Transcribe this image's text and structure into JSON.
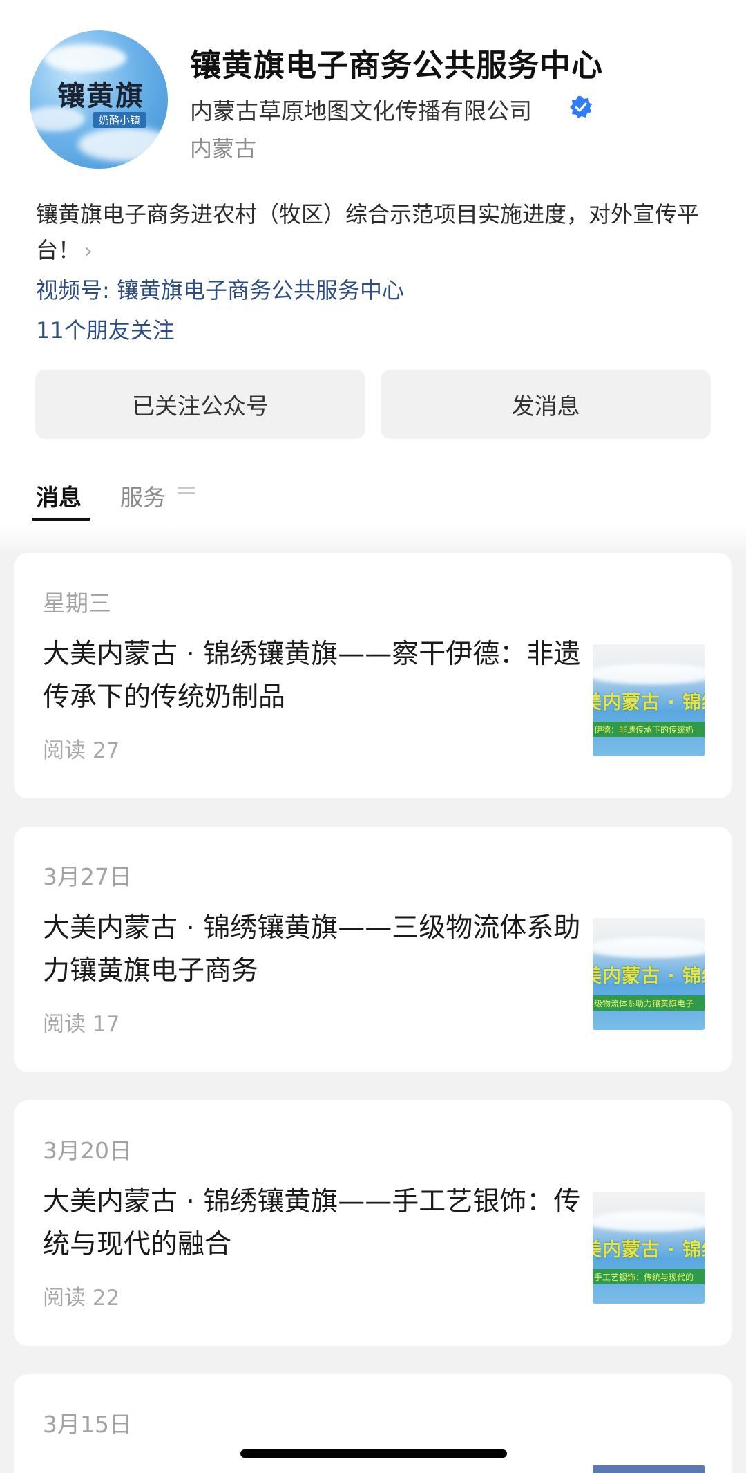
{
  "profile": {
    "avatar_title": "镶黄旗",
    "avatar_subtitle": "奶酪小镇",
    "name": "镶黄旗电子商务公共服务中心",
    "company": "内蒙古草原地图文化传播有限公司",
    "region": "内蒙古",
    "description": "镶黄旗电子商务进农村（牧区）综合示范项目实施进度，对外宣传平台！",
    "chevron": "›",
    "video_channel": "视频号: 镶黄旗电子商务公共服务中心",
    "friends_following": "11个朋友关注",
    "colors": {
      "verified": "#2f7cf6",
      "link": "#2d4d80"
    }
  },
  "actions": {
    "follow_label": "已关注公众号",
    "message_label": "发消息"
  },
  "tabs": {
    "messages": "消息",
    "services": "服务"
  },
  "articles": [
    {
      "date": "星期三",
      "title": "大美内蒙古 · 锦绣镶黄旗——察干伊德：非遗传承下的传统奶制品",
      "reads": "阅读 27",
      "thumb_text": "美内蒙古 · 锦绣镶",
      "thumb_band": "伊德：非遗传承下的传统奶"
    },
    {
      "date": "3月27日",
      "title": "大美内蒙古 · 锦绣镶黄旗——三级物流体系助力镶黄旗电子商务",
      "reads": "阅读 17",
      "thumb_text": "美内蒙古 · 锦绣镶",
      "thumb_band": "级物流体系助力镶黄旗电子"
    },
    {
      "date": "3月20日",
      "title": "大美内蒙古 · 锦绣镶黄旗——手工艺银饰：传统与现代的融合",
      "reads": "阅读 22",
      "thumb_text": "美内蒙古 · 锦绣镶",
      "thumb_band": "手工艺银饰：传统与现代的"
    },
    {
      "date": "3月15日"
    }
  ]
}
